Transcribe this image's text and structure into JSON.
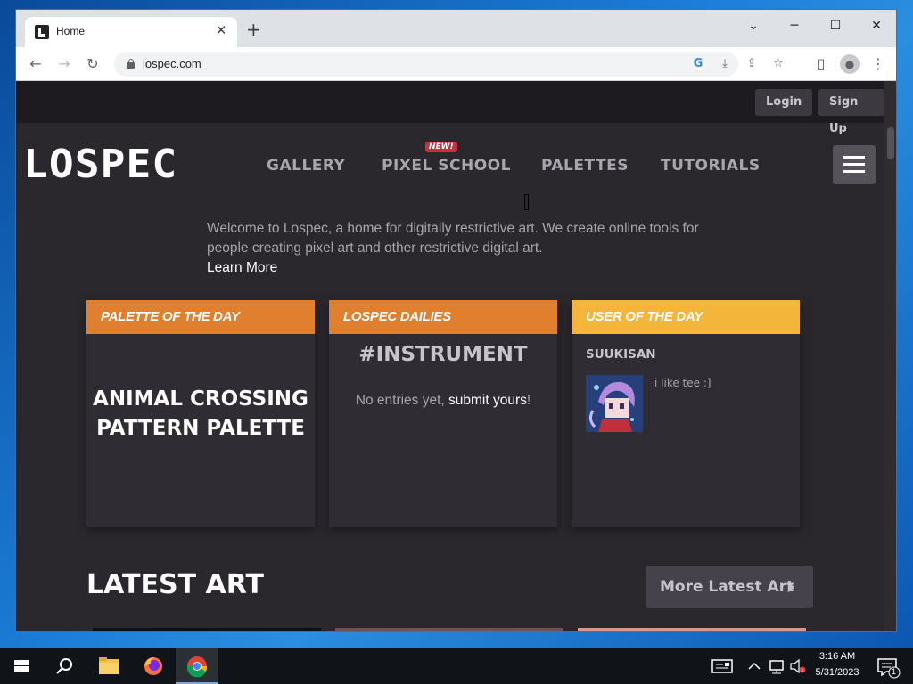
{
  "browser": {
    "tab_title": "Home",
    "tab_close": "✕",
    "new_tab": "+",
    "url": "lospec.com",
    "window_controls": {
      "minimize": "─",
      "maximize": "☐",
      "close": "✕",
      "tab_search": "⌄"
    }
  },
  "site": {
    "top_buttons": {
      "login": "Login",
      "signup": "Sign Up"
    },
    "logo": "LOSPEC",
    "nav": {
      "gallery": "GALLERY",
      "pixel_school": "PIXEL SCHOOL",
      "palettes": "PALETTES",
      "tutorials": "TUTORIALS",
      "new_badge": "NEW!"
    },
    "welcome_text": "Welcome to Lospec, a home for digitally restrictive art. We create online tools for people creating pixel art and other restrictive digital art.",
    "learn_more": "Learn More",
    "cards": {
      "palette_of_day": {
        "header": "PALETTE OF THE DAY",
        "title_line1": "ANIMAL CROSSING",
        "title_line2": "PATTERN PALETTE",
        "color": "#e07f2e"
      },
      "dailies": {
        "header": "LOSPEC DAILIES",
        "tag": "#INSTRUMENT",
        "empty_prefix": "No entries yet, ",
        "empty_link": "submit yours",
        "empty_suffix": "!",
        "color": "#e07f2e"
      },
      "user_of_day": {
        "header": "USER OF THE DAY",
        "username": "SUUKISAN",
        "bio": "i like tee :]",
        "color": "#f4b63a"
      }
    },
    "latest_art": {
      "title": "LATEST ART",
      "more_button": "More Latest Art"
    }
  },
  "taskbar": {
    "time": "3:16 AM",
    "date": "5/31/2023",
    "notification_count": "1"
  },
  "colors": {
    "page_bg": "#2a272d",
    "topbar_bg": "#1d1b20",
    "accent_orange": "#e07f2e",
    "accent_yellow": "#f4b63a"
  }
}
